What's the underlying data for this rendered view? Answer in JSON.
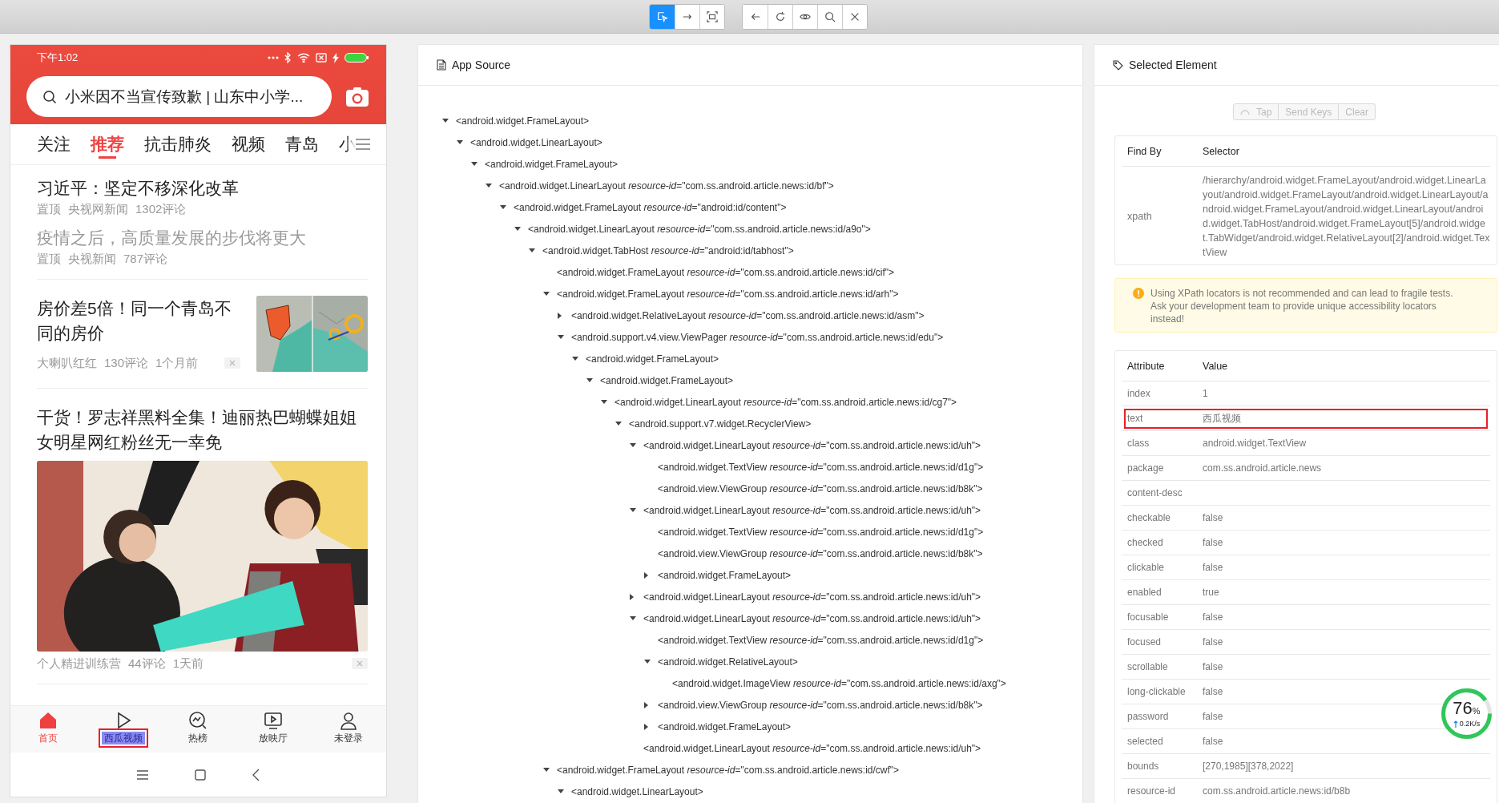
{
  "toolbar": {
    "groups": [
      {
        "buttons": [
          {
            "kind": "select",
            "selected": true
          },
          {
            "kind": "swipe",
            "selected": false
          },
          {
            "kind": "tap-area",
            "selected": false
          }
        ]
      },
      {
        "buttons": [
          {
            "kind": "back"
          },
          {
            "kind": "refresh"
          },
          {
            "kind": "show"
          },
          {
            "kind": "search"
          },
          {
            "kind": "close"
          }
        ]
      }
    ]
  },
  "device": {
    "status_bar": {
      "time": "下午1:02"
    },
    "search": {
      "placeholder": "小米因不当宣传致歉 | 山东中小学..."
    },
    "tabs": [
      {
        "label": "关注",
        "selected": false
      },
      {
        "label": "推荐",
        "selected": true
      },
      {
        "label": "抗击肺炎",
        "selected": false
      },
      {
        "label": "视频",
        "selected": false
      },
      {
        "label": "青岛",
        "selected": false
      },
      {
        "label": "小",
        "selected": false
      }
    ],
    "feed": [
      {
        "kind": "pinned",
        "entries": [
          {
            "title": "习近平：坚定不移深化改革",
            "read": false,
            "meta": [
              "置顶",
              "央视网新闻",
              "1302评论"
            ]
          },
          {
            "title": "疫情之后，高质量发展的步伐将更大",
            "read": true,
            "meta": [
              "置顶",
              "央视新闻",
              "787评论"
            ]
          }
        ]
      },
      {
        "kind": "thumb",
        "title": "房价差5倍！同一个青岛不同的房价",
        "meta": [
          "大喇叭红红",
          "130评论",
          "1个月前"
        ]
      },
      {
        "kind": "large",
        "title": "干货！罗志祥黑料全集！迪丽热巴蝴蝶姐姐女明星网红粉丝无一幸免",
        "meta": [
          "个人精进训练营",
          "44评论",
          "1天前"
        ]
      }
    ],
    "nav": [
      {
        "kind": "home",
        "label": "首页",
        "selected": true,
        "inspected": false
      },
      {
        "kind": "play",
        "label": "西瓜视频",
        "selected": false,
        "inspected": true
      },
      {
        "kind": "trending",
        "label": "热榜",
        "selected": false,
        "inspected": false
      },
      {
        "kind": "theater",
        "label": "放映厅",
        "selected": false,
        "inspected": false
      },
      {
        "kind": "profile",
        "label": "未登录",
        "selected": false,
        "inspected": false
      }
    ]
  },
  "source": {
    "title": "App Source",
    "tree": [
      {
        "text": "<android.widget.FrameLayout>",
        "expanded": true,
        "children": [
          {
            "text": "<android.widget.LinearLayout>",
            "expanded": true,
            "children": [
              {
                "text": "<android.widget.FrameLayout>",
                "expanded": true,
                "children": [
                  {
                    "text": "<android.widget.LinearLayout *resource-id*=\"com.ss.android.article.news:id/bf\">",
                    "expanded": true,
                    "children": [
                      {
                        "text": "<android.widget.FrameLayout *resource-id*=\"android:id/content\">",
                        "expanded": true,
                        "children": [
                          {
                            "text": "<android.widget.LinearLayout *resource-id*=\"com.ss.android.article.news:id/a9o\">",
                            "expanded": true,
                            "children": [
                              {
                                "text": "<android.widget.TabHost *resource-id*=\"android:id/tabhost\">",
                                "expanded": true,
                                "children": [
                                  {
                                    "text": "<android.widget.FrameLayout *resource-id*=\"com.ss.android.article.news:id/cif\">"
                                  },
                                  {
                                    "text": "<android.widget.FrameLayout *resource-id*=\"com.ss.android.article.news:id/arh\">",
                                    "expanded": true,
                                    "children": [
                                      {
                                        "text": "<android.widget.RelativeLayout *resource-id*=\"com.ss.android.article.news:id/asm\">",
                                        "expanded": false
                                      },
                                      {
                                        "text": "<android.support.v4.view.ViewPager *resource-id*=\"com.ss.android.article.news:id/edu\">",
                                        "expanded": true,
                                        "children": [
                                          {
                                            "text": "<android.widget.FrameLayout>",
                                            "expanded": true,
                                            "children": [
                                              {
                                                "text": "<android.widget.FrameLayout>",
                                                "expanded": true,
                                                "children": [
                                                  {
                                                    "text": "<android.widget.LinearLayout *resource-id*=\"com.ss.android.article.news:id/cg7\">",
                                                    "expanded": true,
                                                    "children": [
                                                      {
                                                        "text": "<android.support.v7.widget.RecyclerView>",
                                                        "expanded": true,
                                                        "children": [
                                                          {
                                                            "text": "<android.widget.LinearLayout *resource-id*=\"com.ss.android.article.news:id/uh\">",
                                                            "expanded": true,
                                                            "children": [
                                                              {
                                                                "text": "<android.widget.TextView *resource-id*=\"com.ss.android.article.news:id/d1g\">"
                                                              },
                                                              {
                                                                "text": "<android.view.ViewGroup *resource-id*=\"com.ss.android.article.news:id/b8k\">"
                                                              }
                                                            ]
                                                          },
                                                          {
                                                            "text": "<android.widget.LinearLayout *resource-id*=\"com.ss.android.article.news:id/uh\">",
                                                            "expanded": true,
                                                            "children": [
                                                              {
                                                                "text": "<android.widget.TextView *resource-id*=\"com.ss.android.article.news:id/d1g\">"
                                                              },
                                                              {
                                                                "text": "<android.view.ViewGroup *resource-id*=\"com.ss.android.article.news:id/b8k\">"
                                                              },
                                                              {
                                                                "text": "<android.widget.FrameLayout>",
                                                                "expanded": false
                                                              }
                                                            ]
                                                          },
                                                          {
                                                            "text": "<android.widget.LinearLayout *resource-id*=\"com.ss.android.article.news:id/uh\">",
                                                            "expanded": false
                                                          },
                                                          {
                                                            "text": "<android.widget.LinearLayout *resource-id*=\"com.ss.android.article.news:id/uh\">",
                                                            "expanded": true,
                                                            "children": [
                                                              {
                                                                "text": "<android.widget.TextView *resource-id*=\"com.ss.android.article.news:id/d1g\">"
                                                              },
                                                              {
                                                                "text": "<android.widget.RelativeLayout>",
                                                                "expanded": true,
                                                                "children": [
                                                                  {
                                                                    "text": "<android.widget.ImageView *resource-id*=\"com.ss.android.article.news:id/axg\">"
                                                                  }
                                                                ]
                                                              },
                                                              {
                                                                "text": "<android.view.ViewGroup *resource-id*=\"com.ss.android.article.news:id/b8k\">",
                                                                "expanded": false
                                                              },
                                                              {
                                                                "text": "<android.widget.FrameLayout>",
                                                                "expanded": false
                                                              }
                                                            ]
                                                          },
                                                          {
                                                            "text": "<android.widget.LinearLayout *resource-id*=\"com.ss.android.article.news:id/uh\">"
                                                          }
                                                        ]
                                                      }
                                                    ]
                                                  }
                                                ]
                                              }
                                            ]
                                          }
                                        ]
                                      }
                                    ]
                                  },
                                  {
                                    "text": "<android.widget.FrameLayout *resource-id*=\"com.ss.android.article.news:id/cwf\">",
                                    "expanded": true,
                                    "children": [
                                      {
                                        "text": "<android.widget.LinearLayout>",
                                        "expanded": true
                                      }
                                    ]
                                  }
                                ]
                              }
                            ]
                          }
                        ]
                      }
                    ]
                  }
                ]
              }
            ]
          }
        ]
      }
    ]
  },
  "inspector": {
    "title": "Selected Element",
    "actions": [
      {
        "label": "Tap",
        "loading": true,
        "disabled": true
      },
      {
        "label": "Send Keys",
        "loading": false,
        "disabled": true
      },
      {
        "label": "Clear",
        "loading": false,
        "disabled": true
      }
    ],
    "selector_table": {
      "columns": [
        "Find By",
        "Selector"
      ],
      "rows": [
        {
          "find_by": "xpath",
          "selector": "/hierarchy/android.widget.FrameLayout/android.widget.LinearLayout/android.widget.FrameLayout/android.widget.LinearLayout/android.widget.FrameLayout/android.widget.LinearLayout/android.widget.TabHost/android.widget.FrameLayout[5]/android.widget.TabWidget/android.widget.RelativeLayout[2]/android.widget.TextView"
        }
      ]
    },
    "warning": "Using XPath locators is not recommended and can lead to fragile tests.\nAsk your development team to provide unique accessibility locators instead!",
    "attributes": {
      "columns": [
        "Attribute",
        "Value"
      ],
      "rows": [
        {
          "name": "index",
          "value": "1",
          "highlighted": false
        },
        {
          "name": "text",
          "value": "西瓜视频",
          "highlighted": true
        },
        {
          "name": "class",
          "value": "android.widget.TextView",
          "highlighted": false
        },
        {
          "name": "package",
          "value": "com.ss.android.article.news",
          "highlighted": false
        },
        {
          "name": "content-desc",
          "highlighted": false
        },
        {
          "name": "checkable",
          "value": "false",
          "highlighted": false
        },
        {
          "name": "checked",
          "value": "false",
          "highlighted": false
        },
        {
          "name": "clickable",
          "value": "false",
          "highlighted": false
        },
        {
          "name": "enabled",
          "value": "true",
          "highlighted": false
        },
        {
          "name": "focusable",
          "value": "false",
          "highlighted": false
        },
        {
          "name": "focused",
          "value": "false",
          "highlighted": false
        },
        {
          "name": "scrollable",
          "value": "false",
          "highlighted": false
        },
        {
          "name": "long-clickable",
          "value": "false",
          "highlighted": false
        },
        {
          "name": "password",
          "value": "false",
          "highlighted": false
        },
        {
          "name": "selected",
          "value": "false",
          "highlighted": false
        },
        {
          "name": "bounds",
          "value": "[270,1985][378,2022]",
          "highlighted": false
        },
        {
          "name": "resource-id",
          "value": "com.ss.android.article.news:id/b8b",
          "highlighted": false
        }
      ]
    }
  },
  "meter": {
    "value": "76",
    "unit": "%",
    "speed": "0.2K/s"
  }
}
